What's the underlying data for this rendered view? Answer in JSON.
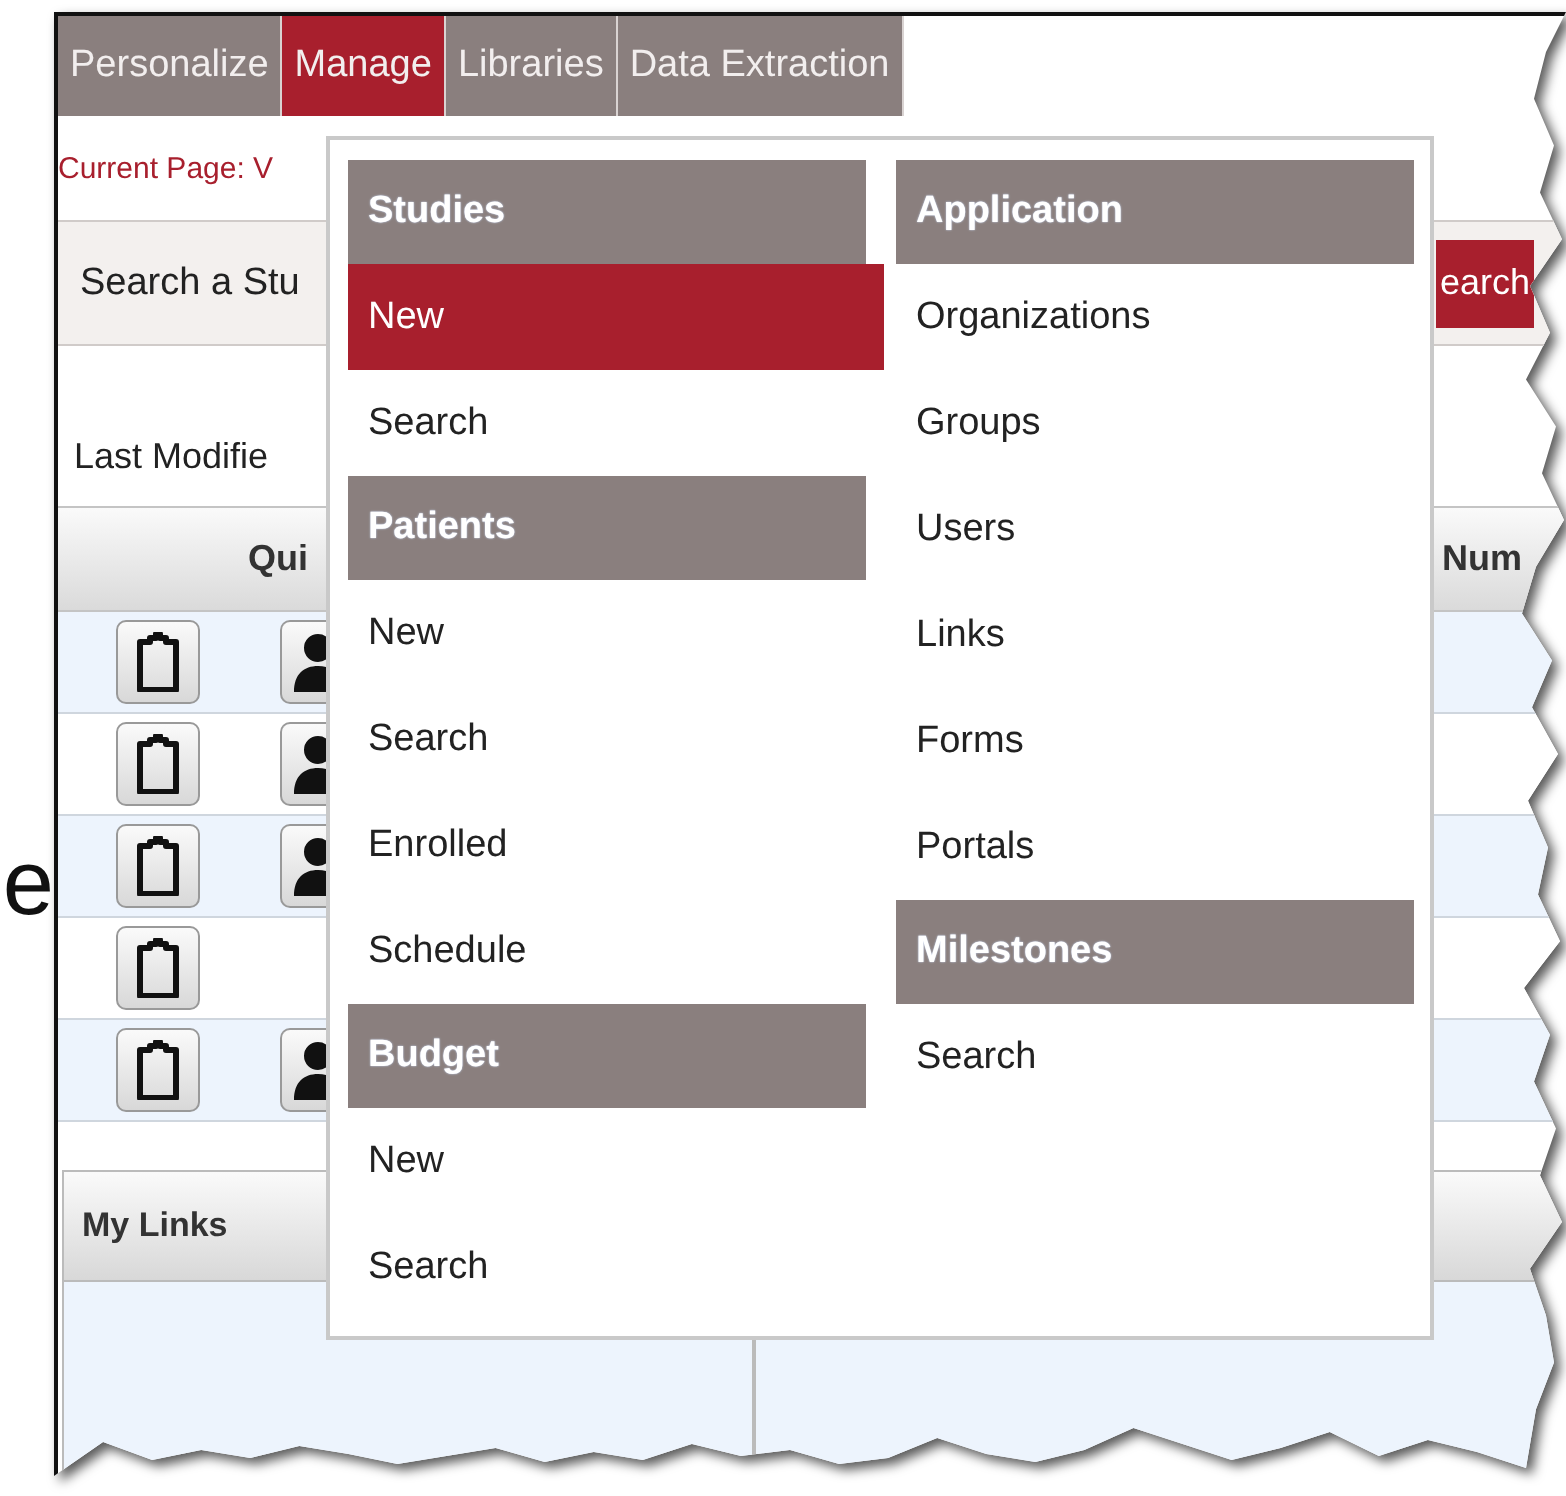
{
  "margin_text": "e",
  "tabs": [
    {
      "label": "Personalize",
      "selected": false
    },
    {
      "label": "Manage",
      "selected": true
    },
    {
      "label": "Libraries",
      "selected": false
    },
    {
      "label": "Data Extraction",
      "selected": false
    }
  ],
  "breadcrumb": "Current Page: V",
  "search_bar": {
    "label": "Search a Stu",
    "button": "earch"
  },
  "last_modified_label": "Last Modifie",
  "table": {
    "columns": [
      "Qui",
      "Num"
    ],
    "rows": [
      {
        "icons": [
          {
            "kind": "clipboard"
          },
          {
            "kind": "person"
          }
        ]
      },
      {
        "icons": [
          {
            "kind": "clipboard"
          },
          {
            "kind": "person"
          }
        ]
      },
      {
        "icons": [
          {
            "kind": "clipboard"
          },
          {
            "kind": "person"
          }
        ]
      },
      {
        "icons": [
          {
            "kind": "clipboard"
          }
        ]
      },
      {
        "icons": [
          {
            "kind": "clipboard"
          },
          {
            "kind": "person"
          }
        ]
      }
    ]
  },
  "panels": [
    {
      "title": "My Links"
    }
  ],
  "menu": {
    "columns": [
      {
        "sections": [
          {
            "title": "Studies",
            "items": [
              {
                "label": "New",
                "selected": true
              },
              {
                "label": "Search",
                "selected": false
              }
            ]
          },
          {
            "title": "Patients",
            "items": [
              {
                "label": "New",
                "selected": false
              },
              {
                "label": "Search",
                "selected": false
              },
              {
                "label": "Enrolled",
                "selected": false
              },
              {
                "label": "Schedule",
                "selected": false
              }
            ]
          },
          {
            "title": "Budget",
            "items": [
              {
                "label": "New",
                "selected": false
              },
              {
                "label": "Search",
                "selected": false
              }
            ]
          }
        ]
      },
      {
        "sections": [
          {
            "title": "Application",
            "items": [
              {
                "label": "Organizations",
                "selected": false
              },
              {
                "label": "Groups",
                "selected": false
              },
              {
                "label": "Users",
                "selected": false
              },
              {
                "label": "Links",
                "selected": false
              },
              {
                "label": "Forms",
                "selected": false
              },
              {
                "label": "Portals",
                "selected": false
              }
            ]
          },
          {
            "title": "Milestones",
            "items": [
              {
                "label": "Search",
                "selected": false
              }
            ]
          }
        ]
      }
    ]
  }
}
